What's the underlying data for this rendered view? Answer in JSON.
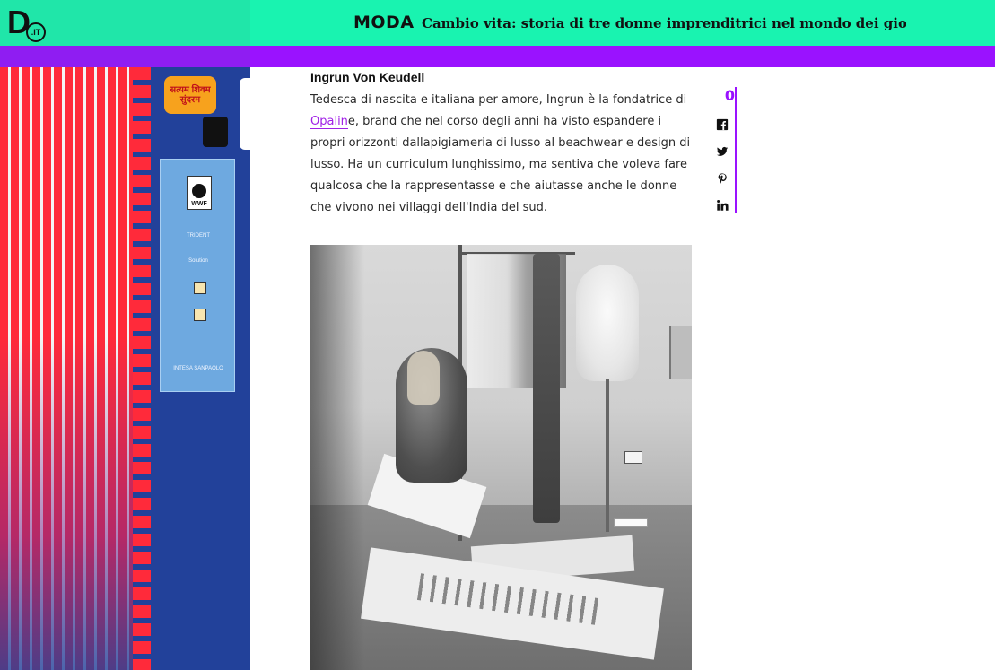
{
  "header": {
    "logo_letter": "D",
    "logo_badge": ".IT",
    "section": "MODA",
    "headline": "Cambio vita: storia di tre donne imprenditrici nel mondo dei gioielli e ..."
  },
  "colors": {
    "header_bg": "#19f3b0",
    "bar_purple": "#9a12ff",
    "link": "#a020e6"
  },
  "ad": {
    "logo1_text": "सत्यम शिवम सुंदरम",
    "panel_items": [
      "WWF",
      "TRIDENT",
      "Solution",
      "",
      "",
      "INTESA SANPAOLO"
    ]
  },
  "article": {
    "author": "Ingrun Von Keudell",
    "text_before_link": "Tedesca di nascita e italiana per amore, Ingrun è la fondatrice di ",
    "link_text": "Opalin",
    "text_after_link": "e, brand che nel corso degli anni ha visto espandere i propri orizzonti dallapigiameria di lusso al beachwear e design di lusso. Ha un curriculum lunghissimo, ma sentiva che voleva fare qualcosa che la rappresentasse e che aiutasse anche le donne che vivono nei villaggi dell'India del sud."
  },
  "share": {
    "count": "0",
    "icons": [
      "facebook-icon",
      "twitter-icon",
      "pinterest-icon",
      "linkedin-icon"
    ]
  }
}
